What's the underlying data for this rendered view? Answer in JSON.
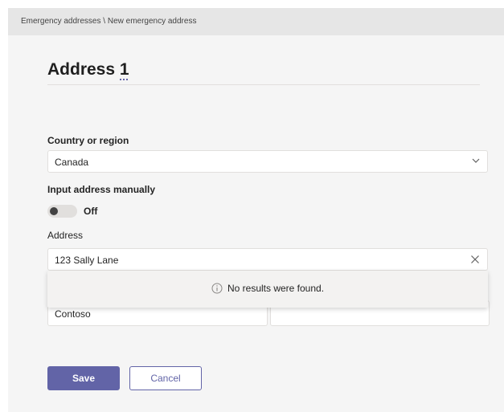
{
  "breadcrumb": {
    "parent": "Emergency addresses",
    "separator": " \\ ",
    "current": "New emergency address"
  },
  "header": {
    "title_prefix": "Address ",
    "title_number": "1"
  },
  "form": {
    "country": {
      "label": "Country or region",
      "value": "Canada",
      "icon": "chevron-down-icon"
    },
    "manual": {
      "label": "Input address manually",
      "toggle_on": false,
      "state_text": "Off"
    },
    "address": {
      "label": "Address",
      "value": "123 Sally Lane",
      "clear_icon": "close-icon"
    },
    "organization": {
      "value": "Contoso"
    },
    "second_field": {
      "value": ""
    }
  },
  "lookup_popup": {
    "icon": "info-icon",
    "message": "No results were found."
  },
  "actions": {
    "save_label": "Save",
    "cancel_label": "Cancel"
  },
  "colors": {
    "accent": "#6264a7",
    "page_bg": "#f5f5f5",
    "breadcrumb_bg": "#e6e6e6"
  }
}
